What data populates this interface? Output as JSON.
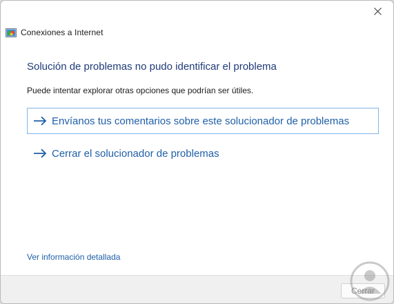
{
  "window": {
    "app_name": "Conexiones a Internet",
    "icons": {
      "close": "close-icon",
      "app": "network-icon"
    }
  },
  "content": {
    "heading": "Solución de problemas no pudo identificar el problema",
    "subtext": "Puede intentar explorar otras opciones que podrían ser útiles.",
    "options": [
      {
        "label": "Envíanos tus comentarios sobre este solucionador de problemas",
        "icon": "arrow-right-icon",
        "focused": true
      },
      {
        "label": "Cerrar el solucionador de problemas",
        "icon": "arrow-right-icon",
        "focused": false
      }
    ],
    "details_link": "Ver información detallada"
  },
  "footer": {
    "close_label": "Cerrar"
  },
  "colors": {
    "heading": "#1e3a78",
    "link": "#1f5fa8",
    "focus_border": "#7eb4ea",
    "footer_bg": "#f0f0f0"
  }
}
